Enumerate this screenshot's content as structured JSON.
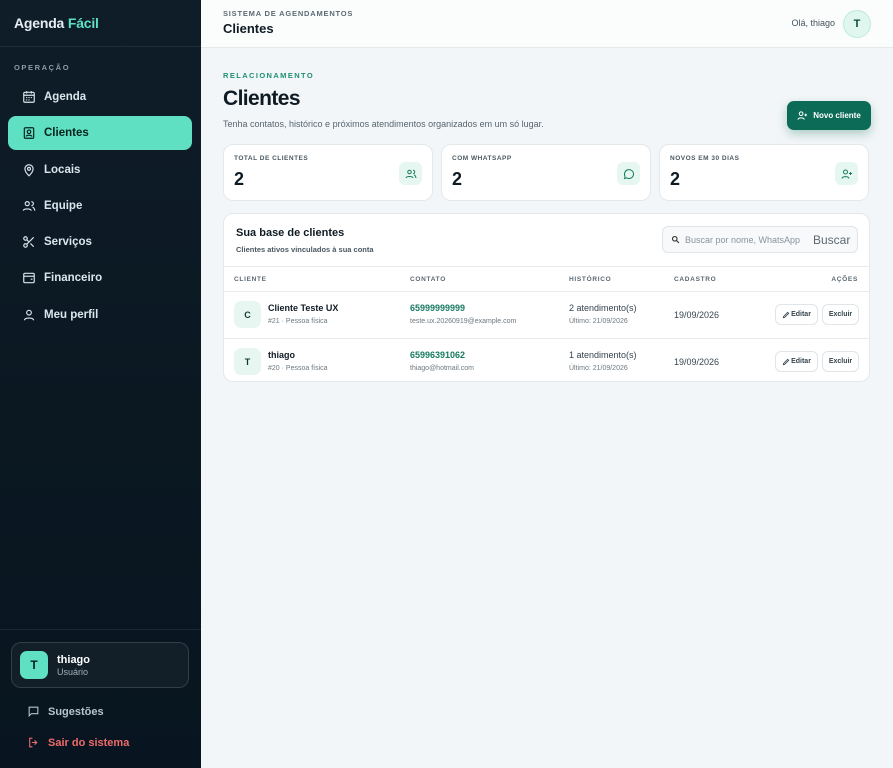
{
  "brand": {
    "name": "Agenda",
    "accent": "Fácil"
  },
  "sidebar": {
    "section_label": "OPERAÇÃO",
    "items": [
      {
        "label": "Agenda",
        "icon": "calendar-icon",
        "active": false
      },
      {
        "label": "Clientes",
        "icon": "contact-icon",
        "active": true
      },
      {
        "label": "Locais",
        "icon": "map-pin-icon",
        "active": false
      },
      {
        "label": "Equipe",
        "icon": "users-icon",
        "active": false
      },
      {
        "label": "Serviços",
        "icon": "scissors-icon",
        "active": false
      },
      {
        "label": "Financeiro",
        "icon": "wallet-icon",
        "active": false
      },
      {
        "label": "Meu perfil",
        "icon": "user-icon",
        "active": false
      }
    ],
    "user": {
      "initial": "T",
      "name": "thiago",
      "role": "Usuário"
    },
    "suggestions": "Sugestões",
    "logout": "Sair do sistema"
  },
  "topbar": {
    "kicker": "SISTEMA DE AGENDAMENTOS",
    "title": "Clientes",
    "greeting": "Olá, thiago",
    "avatar": "T"
  },
  "page": {
    "kicker": "RELACIONAMENTO",
    "title": "Clientes",
    "subtitle": "Tenha contatos, histórico e próximos atendimentos organizados em um só lugar.",
    "new_button": "Novo cliente"
  },
  "stats": [
    {
      "label": "TOTAL DE CLIENTES",
      "value": "2",
      "icon": "users-icon"
    },
    {
      "label": "COM WHATSAPP",
      "value": "2",
      "icon": "message-circle-icon"
    },
    {
      "label": "NOVOS EM 30 DIAS",
      "value": "2",
      "icon": "user-plus-icon"
    }
  ],
  "table": {
    "title": "Sua base de clientes",
    "subtitle": "Clientes ativos vinculados à sua conta",
    "search_placeholder": "Buscar por nome, WhatsApp",
    "search_button": "Buscar",
    "columns": [
      "CLIENTE",
      "CONTATO",
      "HISTÓRICO",
      "CADASTRO",
      "AÇÕES"
    ],
    "rows": [
      {
        "initial": "C",
        "name": "Cliente Teste UX",
        "meta": "#21 · Pessoa física",
        "phone": "65999999999",
        "email": "teste.ux.20260919@example.com",
        "history": "2 atendimento(s)",
        "last": "Último: 21/09/2026",
        "date": "19/09/2026",
        "edit": "Editar",
        "delete": "Excluir"
      },
      {
        "initial": "T",
        "name": "thiago",
        "meta": "#20 · Pessoa física",
        "phone": "65996391062",
        "email": "thiago@hotmail.com",
        "history": "1 atendimento(s)",
        "last": "Último: 21/09/2026",
        "date": "19/09/2026",
        "edit": "Editar",
        "delete": "Excluir"
      }
    ]
  },
  "colors": {
    "accent": "#5fe0c3",
    "primary": "#0c6b56",
    "sidebar": "#0b1822",
    "danger": "#f06a6a"
  }
}
